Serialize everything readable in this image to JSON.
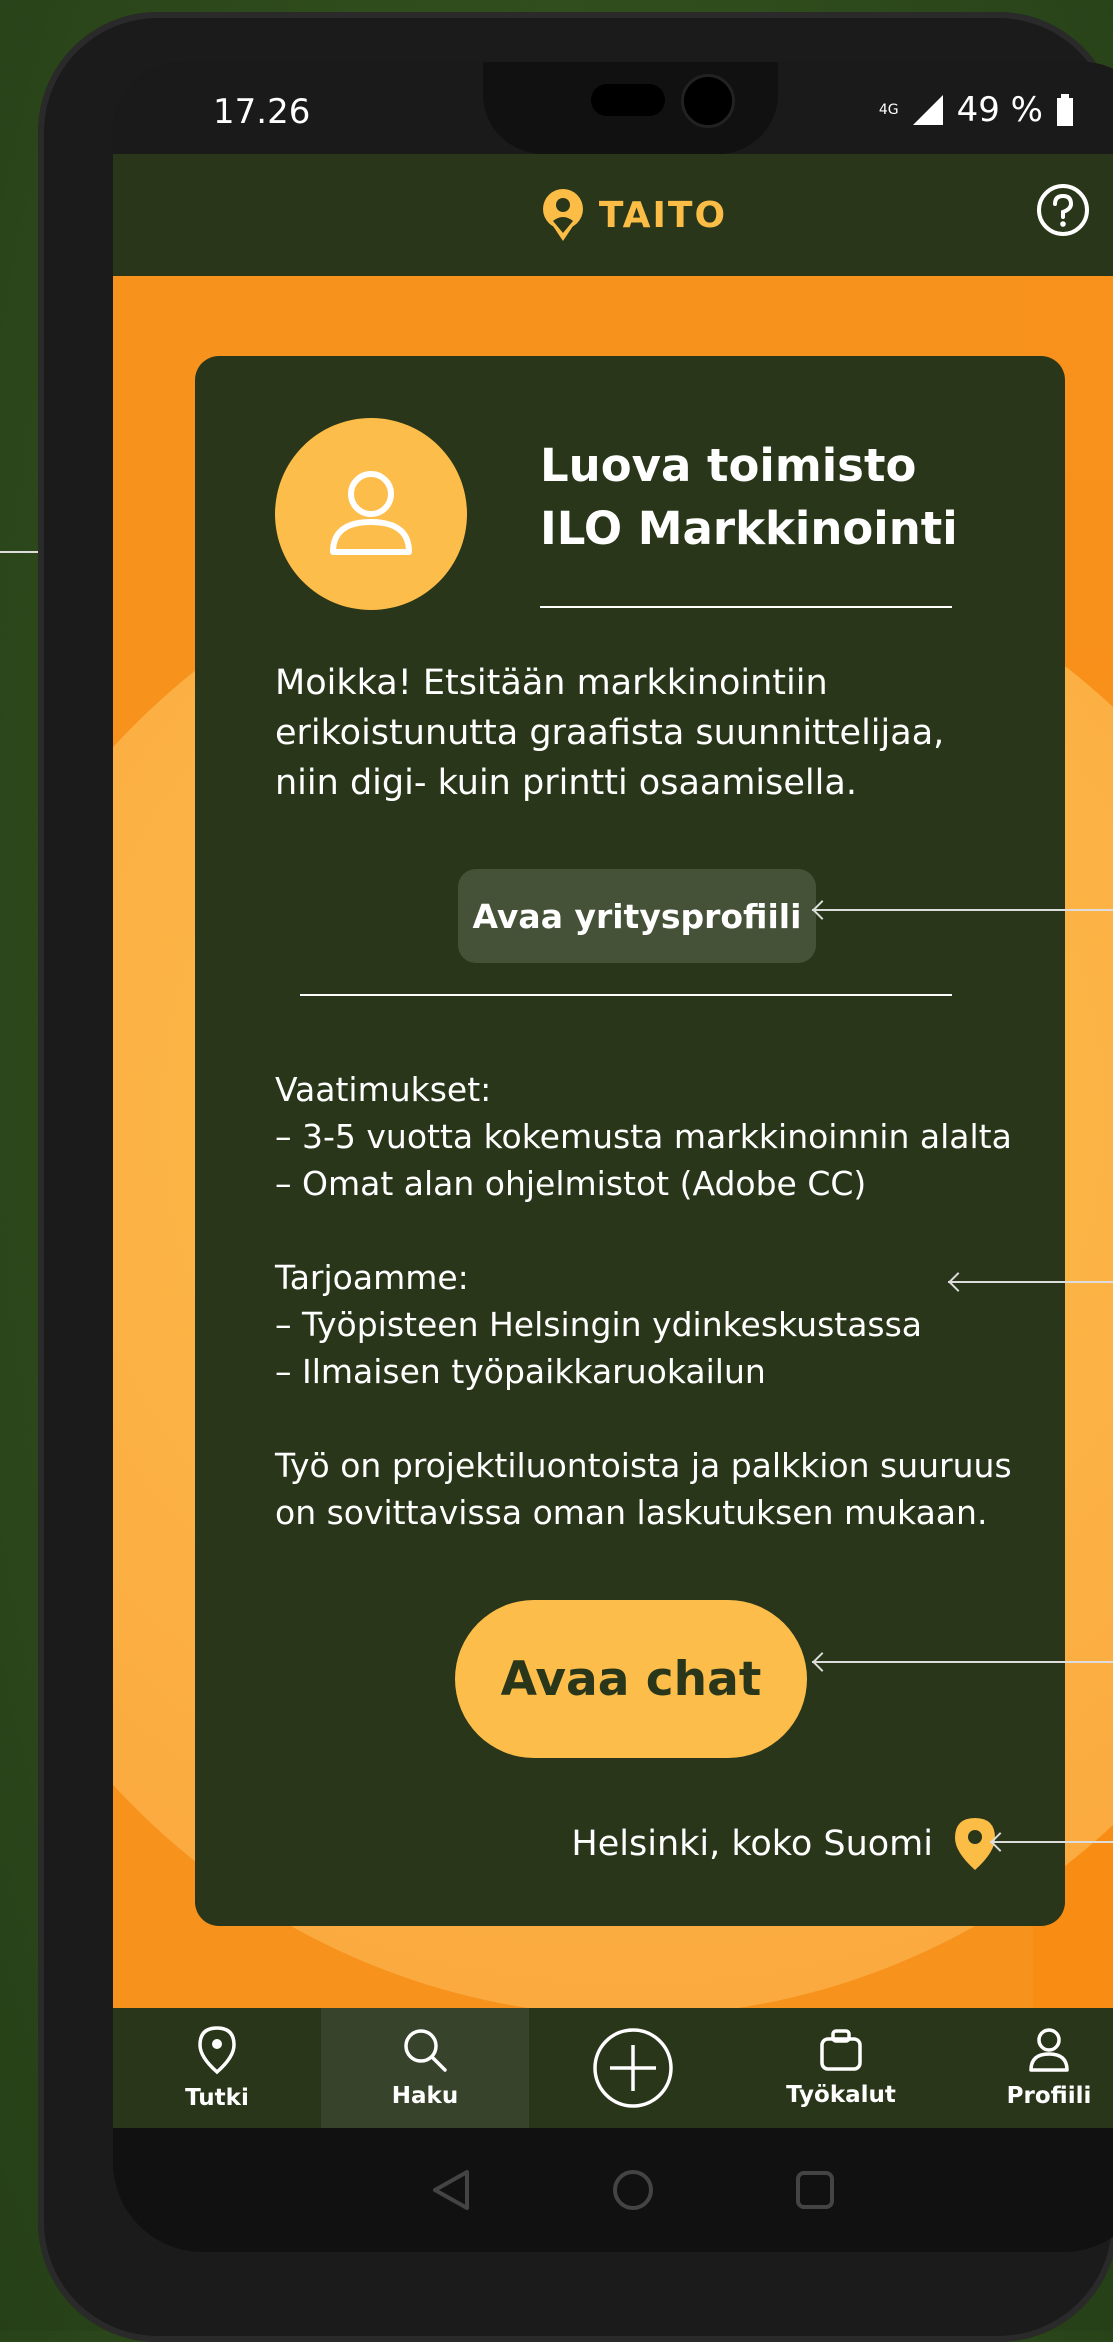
{
  "status": {
    "time": "17.26",
    "network": "4G",
    "battery": "49 %"
  },
  "header": {
    "logo_text": "TAITO",
    "help_icon": "question-circle-icon"
  },
  "card": {
    "company": "Luova toimisto ILO Markkinointi",
    "intro": "Moikka! Etsitään markkinointiin erikoistunutta graafista suunnittelijaa, niin digi- kuin printti osaamisella.",
    "profile_button": "Avaa yritysprofiili",
    "requirements_title": "Vaatimukset:",
    "requirements": [
      "– 3-5 vuotta kokemusta markkinoinnin alalta",
      "– Omat alan ohjelmistot (Adobe CC)"
    ],
    "offers_title": "Tarjoamme:",
    "offers": [
      "– Työpisteen Helsingin ydinkeskustassa",
      "– Ilmaisen työpaikkaruokailun"
    ],
    "closing": "Työ on projektiluontoista ja palkkion suuruus on sovittavissa oman laskutuksen mukaan.",
    "chat_button": "Avaa chat",
    "location": "Helsinki, koko Suomi"
  },
  "nav": {
    "items": [
      {
        "label": "Tutki",
        "icon": "location-pin-icon"
      },
      {
        "label": "Haku",
        "icon": "search-icon",
        "active": true
      },
      {
        "label": "",
        "icon": "add-circle-icon"
      },
      {
        "label": "Työkalut",
        "icon": "briefcase-icon"
      },
      {
        "label": "Profiili",
        "icon": "user-icon"
      }
    ]
  },
  "colors": {
    "dark_green": "#29361a",
    "orange": "#f7921c",
    "yellow": "#fdbd4a"
  }
}
